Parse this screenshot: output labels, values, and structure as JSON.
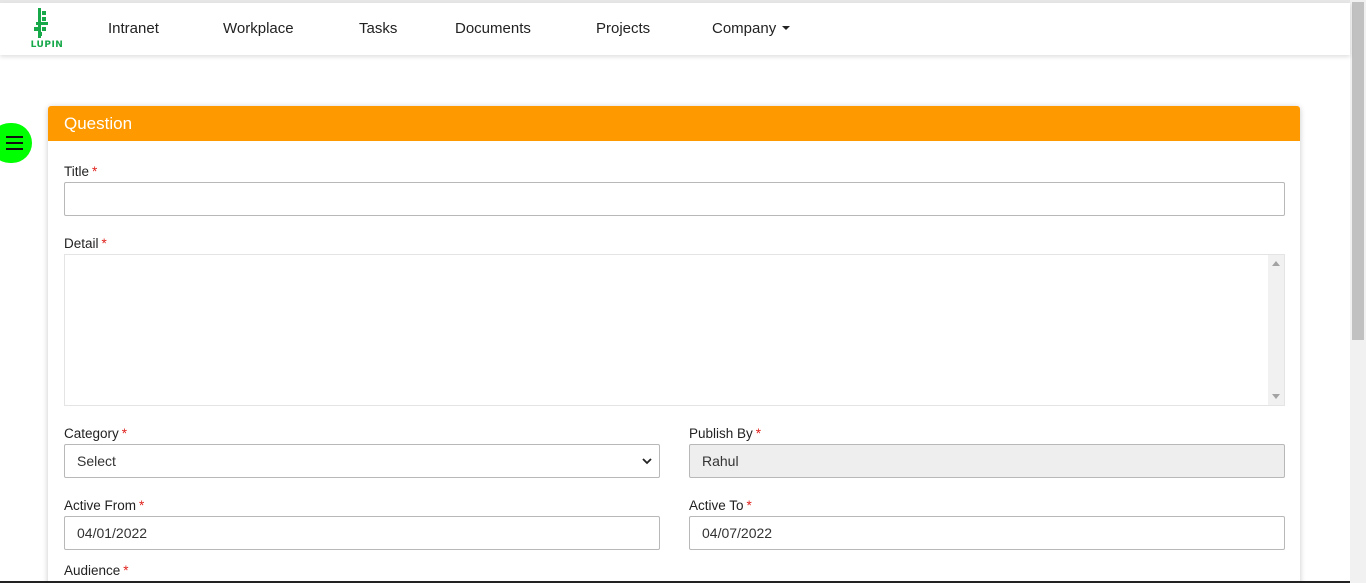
{
  "brand": {
    "logo_text": "LUPIN",
    "color": "#17a84a"
  },
  "nav": {
    "items": [
      {
        "label": "Intranet"
      },
      {
        "label": "Workplace"
      },
      {
        "label": "Tasks"
      },
      {
        "label": "Documents"
      },
      {
        "label": "Projects"
      },
      {
        "label": "Company"
      }
    ]
  },
  "menu_toggle": {
    "icon": "hamburger-icon",
    "color": "#00ff00"
  },
  "form": {
    "header_title": "Question",
    "header_color": "#ff9900",
    "required_mark": "*",
    "title": {
      "label": "Title",
      "value": ""
    },
    "detail": {
      "label": "Detail",
      "value": ""
    },
    "category": {
      "label": "Category",
      "selected": "Select"
    },
    "publish_by": {
      "label": "Publish By",
      "value": "Rahul"
    },
    "active_from": {
      "label": "Active From",
      "value": "04/01/2022"
    },
    "active_to": {
      "label": "Active To",
      "value": "04/07/2022"
    },
    "audience": {
      "label": "Audience"
    }
  }
}
